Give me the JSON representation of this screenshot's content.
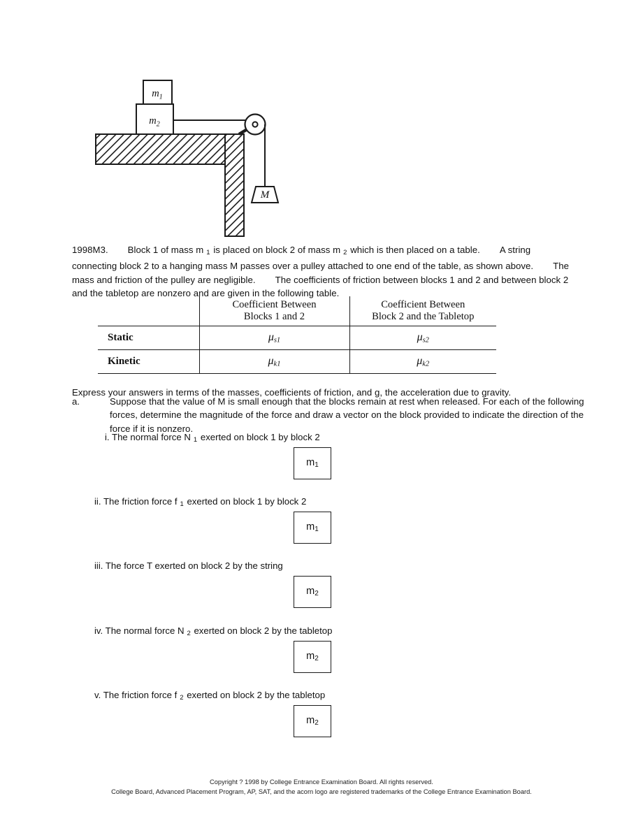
{
  "figure": {
    "name": "pulley-table-diagram",
    "block_top_label": "m",
    "block_top_sub": "1",
    "block_bottom_label": "m",
    "block_bottom_sub": "2",
    "hanging_mass_label": "M"
  },
  "intro": {
    "problem_id": "1998M3.",
    "s1": "Block 1 of mass m",
    "s1_sub": "1",
    "s2": "is placed on block 2 of mass m",
    "s2_sub": "2",
    "s3": "which is then placed on a table.",
    "s4": "A string connecting block 2 to a hanging mass M passes over a pulley attached to one end of the table, as shown above.",
    "s5": "The mass and friction of the pulley are negligible.",
    "s6": "The coefficients of friction between blocks 1 and 2 and between block 2 and the tabletop are nonzero and are given in the following table."
  },
  "coef_table": {
    "header_col1_line1": "Coefficient Between",
    "header_col1_line2": "Blocks 1 and 2",
    "header_col2_line1": "Coefficient Between",
    "header_col2_line2": "Block 2 and the Tabletop",
    "rows": [
      {
        "label": "Static",
        "c1_symbol": "μ",
        "c1_sub": "s1",
        "c2_symbol": "μ",
        "c2_sub": "s2"
      },
      {
        "label": "Kinetic",
        "c1_symbol": "μ",
        "c1_sub": "k1",
        "c2_symbol": "μ",
        "c2_sub": "k2"
      }
    ]
  },
  "instructions": {
    "express": "Express your answers in terms of the masses, coefficients of friction, and g, the acceleration due to gravity.",
    "part_label": "a.",
    "part_a_text": "Suppose that the value of M is small enough that the blocks remain at rest when released. For each of the following forces, determine the magnitude of the force and draw a vector on the block provided to indicate the direction of the force if it is nonzero."
  },
  "items": [
    {
      "prefix": "i. The normal force N",
      "sub": "1",
      "suffix": "exerted on block 1 by block 2",
      "box_label": "m",
      "box_sub": "1"
    },
    {
      "prefix": "ii. The friction force f",
      "sub": "1",
      "suffix": "exerted on block 1 by block 2",
      "box_label": "m",
      "box_sub": "1"
    },
    {
      "prefix": "iii. The force T exerted on block 2 by the string",
      "sub": "",
      "suffix": "",
      "box_label": "m",
      "box_sub": "2"
    },
    {
      "prefix": "iv. The normal force N",
      "sub": "2",
      "suffix": "exerted on block 2 by the tabletop",
      "box_label": "m",
      "box_sub": "2"
    },
    {
      "prefix": "v. The friction force f",
      "sub": "2",
      "suffix": "exerted on block 2 by the tabletop",
      "box_label": "m",
      "box_sub": "2"
    }
  ],
  "footer": {
    "line1": "Copyright ? 1998 by College Entrance Examination Board. All rights reserved.",
    "line2": "College Board, Advanced Placement Program, AP, SAT, and the acorn logo are registered trademarks of the College Entrance Examination Board."
  },
  "colors": {
    "ink": "#111111",
    "paper": "#ffffff",
    "rule": "#1b1b1b"
  }
}
